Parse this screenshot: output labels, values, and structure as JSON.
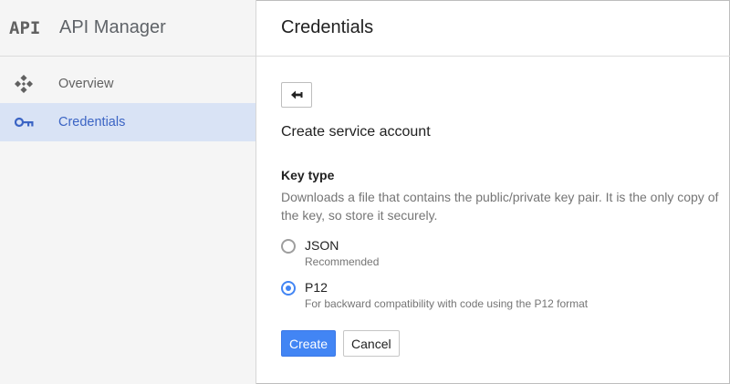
{
  "brand": {
    "logo_text": "API",
    "title": "API Manager"
  },
  "sidebar": {
    "items": [
      {
        "label": "Overview",
        "icon": "overview-diamond-icon",
        "active": false
      },
      {
        "label": "Credentials",
        "icon": "key-icon",
        "active": true
      }
    ]
  },
  "header": {
    "title": "Credentials"
  },
  "form": {
    "back_icon": "back-arrow-icon",
    "title": "Create service account",
    "key_type_label": "Key type",
    "key_type_description": "Downloads a file that contains the public/private key pair. It is the only copy of the key, so store it securely.",
    "options": [
      {
        "label": "JSON",
        "sublabel": "Recommended",
        "checked": false
      },
      {
        "label": "P12",
        "sublabel": "For backward compatibility with code using the P12 format",
        "checked": true
      }
    ],
    "create_label": "Create",
    "cancel_label": "Cancel"
  },
  "colors": {
    "accent": "#4285f4",
    "active_nav_bg": "#d9e3f5",
    "active_nav_text": "#3b64c4",
    "sidebar_bg": "#f5f5f5"
  }
}
